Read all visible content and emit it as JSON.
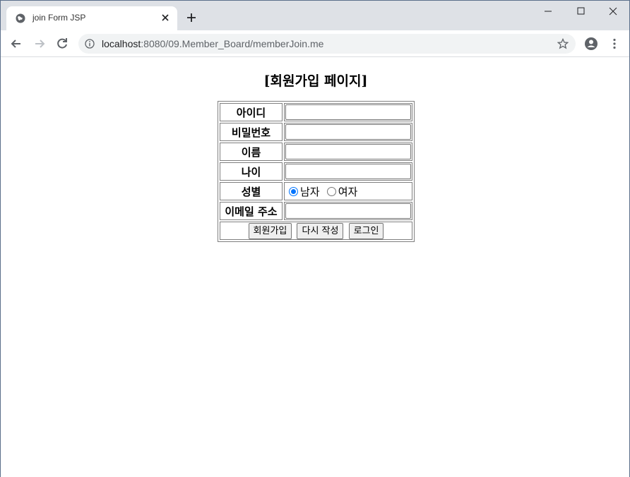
{
  "browser": {
    "tab_title": "join Form JSP",
    "url_host": "localhost",
    "url_path": ":8080/09.Member_Board/memberJoin.me"
  },
  "page": {
    "heading": "[회원가입 페이지]"
  },
  "form": {
    "fields": [
      {
        "label": "아이디",
        "value": ""
      },
      {
        "label": "비밀번호",
        "value": ""
      },
      {
        "label": "이름",
        "value": ""
      },
      {
        "label": "나이",
        "value": ""
      }
    ],
    "gender": {
      "label": "성별",
      "options": [
        "남자",
        "여자"
      ],
      "selected": "남자"
    },
    "email": {
      "label": "이메일 주소",
      "value": ""
    },
    "buttons": {
      "join": "회원가입",
      "reset": "다시 작성",
      "login": "로그인"
    }
  },
  "colors": {
    "tabstrip": "#dee1e6",
    "radio_accent": "#0075ff"
  }
}
